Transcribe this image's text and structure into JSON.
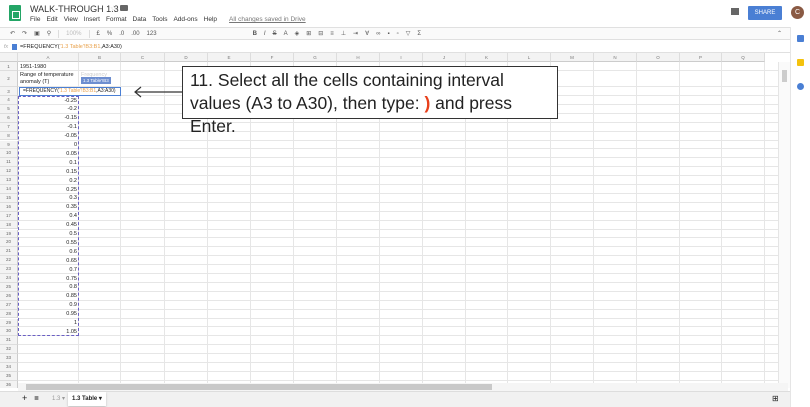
{
  "header": {
    "title": "WALK-THROUGH 1.3",
    "menu": [
      "File",
      "Edit",
      "View",
      "Insert",
      "Format",
      "Data",
      "Tools",
      "Add-ons",
      "Help"
    ],
    "saved_status": "All changes saved in Drive",
    "share_label": "SHARE",
    "avatar_letter": "C"
  },
  "toolbar": {
    "zoom": "100%",
    "currency": "£",
    "percent": "%",
    "decimals_less": ".0",
    "decimals_more": ".00",
    "format": "123",
    "bold": "B",
    "italic": "I",
    "strike": "S",
    "text_color": "A",
    "sum": "Σ"
  },
  "formula_bar": {
    "fx": "fx",
    "formula_prefix": "=FREQUENCY(",
    "formula_ref1": "'1.3 Table'!B3:B1",
    "formula_suffix": ",A3:A30)"
  },
  "columns": [
    "A",
    "B",
    "C",
    "D",
    "E",
    "F",
    "G",
    "H",
    "I",
    "J",
    "K",
    "L",
    "M",
    "N",
    "O",
    "P",
    "Q"
  ],
  "cells": {
    "A1": "1951-1980",
    "A2_line1": "Range of temperature",
    "A2_line2": "anomaly (T)",
    "B2": "Frequency",
    "tooltip": "1.3 Table'!B3",
    "editor_prefix": "=FREQUENCY(",
    "editor_ref1": "'1.3 Table'!B3:B1",
    "editor_suffix": ",A3:A30)"
  },
  "interval_values": [
    "-0.25",
    "-0.2",
    "-0.15",
    "-0.1",
    "-0.05",
    "0",
    "0.05",
    "0.1",
    "0.15",
    "0.2",
    "0.25",
    "0.3",
    "0.35",
    "0.4",
    "0.45",
    "0.5",
    "0.55",
    "0.6",
    "0.65",
    "0.7",
    "0.75",
    "0.8",
    "0.85",
    "0.9",
    "0.95",
    "1",
    "1.05"
  ],
  "row_count": 36,
  "callout": {
    "text_part1": "11. Select all the cells containing interval values (A3 to A30), then type: ",
    "highlight": ")",
    "text_part2": " and press Enter."
  },
  "sheet_tabs": [
    {
      "label": "1.3",
      "active": false
    },
    {
      "label": "1.3 Table",
      "active": true
    }
  ],
  "colors": {
    "accent": "#4a7fd4",
    "selection": "#6a5fc4",
    "highlight": "#e8401c",
    "brand": "#23a566"
  }
}
